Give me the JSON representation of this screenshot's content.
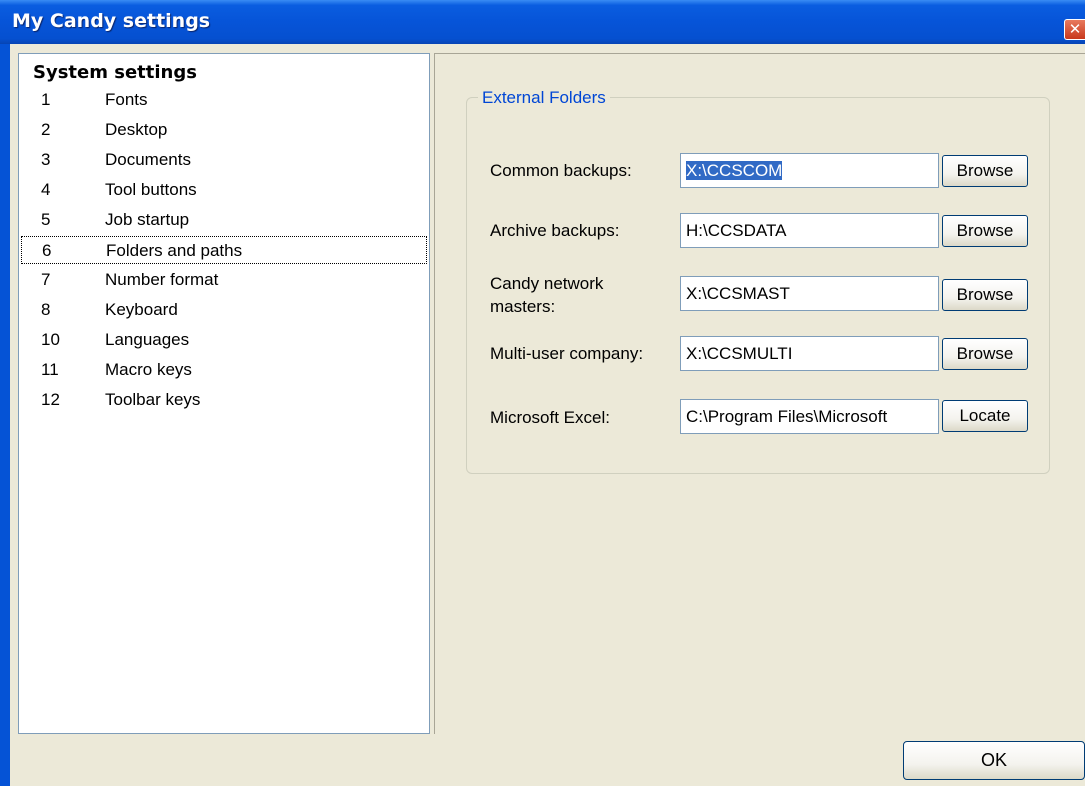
{
  "window": {
    "title": "My Candy settings",
    "close_icon": "close-icon",
    "colors": {
      "titlebar": "#0654d8",
      "selection": "#316ac5",
      "legend": "#0046d5",
      "face": "#ece9d8"
    }
  },
  "tree": {
    "root_label": "System settings",
    "items": [
      {
        "num": "1",
        "label": "Fonts"
      },
      {
        "num": "2",
        "label": "Desktop"
      },
      {
        "num": "3",
        "label": "Documents"
      },
      {
        "num": "4",
        "label": "Tool buttons"
      },
      {
        "num": "5",
        "label": "Job startup"
      },
      {
        "num": "6",
        "label": "Folders and paths",
        "focused": true
      },
      {
        "num": "7",
        "label": "Number format"
      },
      {
        "num": "8",
        "label": "Keyboard"
      },
      {
        "num": "10",
        "label": "Languages"
      },
      {
        "num": "11",
        "label": "Macro keys"
      },
      {
        "num": "12",
        "label": "Toolbar keys"
      }
    ]
  },
  "folders": {
    "group_title": "External Folders",
    "fields": [
      {
        "label": "Common backups:",
        "value": "X:\\CCSCOM",
        "button": "Browse",
        "selected": true
      },
      {
        "label": "Archive backups:",
        "value": "H:\\CCSDATA",
        "button": "Browse"
      },
      {
        "label_line1": "Candy network",
        "label_line2": "masters:",
        "value": "X:\\CCSMAST",
        "button": "Browse"
      },
      {
        "label": "Multi-user company:",
        "value": "X:\\CCSMULTI",
        "button": "Browse"
      },
      {
        "label": "Microsoft Excel:",
        "value": "C:\\Program Files\\Microsoft",
        "button": "Locate"
      }
    ]
  },
  "footer": {
    "ok_label": "OK"
  }
}
